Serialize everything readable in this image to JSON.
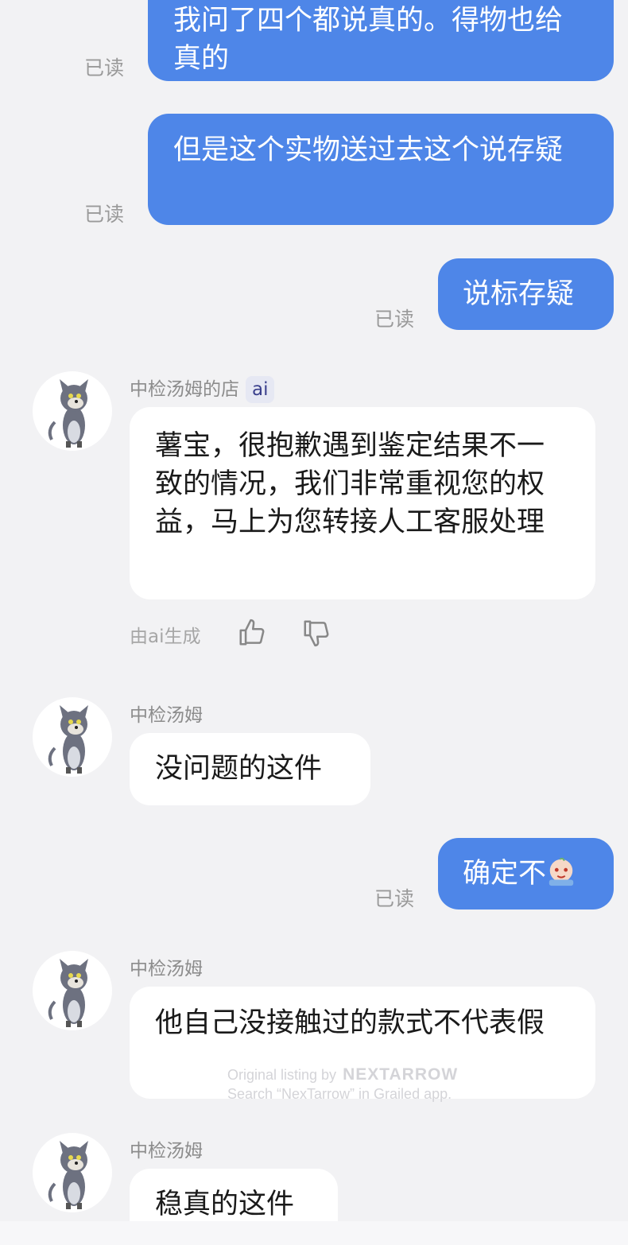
{
  "messages": [
    {
      "sender": "me",
      "text": "我问了四个都说真的。得物也给真的",
      "read_label": "已读"
    },
    {
      "sender": "me",
      "text": "但是这个实物送过去这个说存疑",
      "read_label": "已读"
    },
    {
      "sender": "me",
      "text": "说标存疑",
      "read_label": "已读"
    },
    {
      "sender": "shop",
      "name": "中检汤姆的店",
      "tag": "ai",
      "text": "薯宝，很抱歉遇到鉴定结果不一致的情况，我们非常重视您的权益，马上为您转接人工客服处理",
      "ai_note": "由ai生成"
    },
    {
      "sender": "shop",
      "name": "中检汤姆",
      "text": "没问题的这件"
    },
    {
      "sender": "me",
      "text": "确定不",
      "read_label": "已读"
    },
    {
      "sender": "shop",
      "name": "中检汤姆",
      "text": "他自己没接触过的款式不代表假"
    },
    {
      "sender": "shop",
      "name": "中检汤姆",
      "text": "稳真的这件"
    }
  ],
  "watermark": {
    "line1": "Original listing by",
    "brand": "NEXTARROW",
    "line2": "Search “NexTarrow” in Grailed app."
  },
  "icons": {
    "avatar": "tom-cat-avatar",
    "thumbs_up": "thumbs-up-icon",
    "thumbs_down": "thumbs-down-icon",
    "emoji": "crying-face-emoji"
  },
  "colors": {
    "outgoing_bubble": "#4e86e8",
    "incoming_bubble": "#ffffff",
    "background": "#f2f2f4"
  }
}
